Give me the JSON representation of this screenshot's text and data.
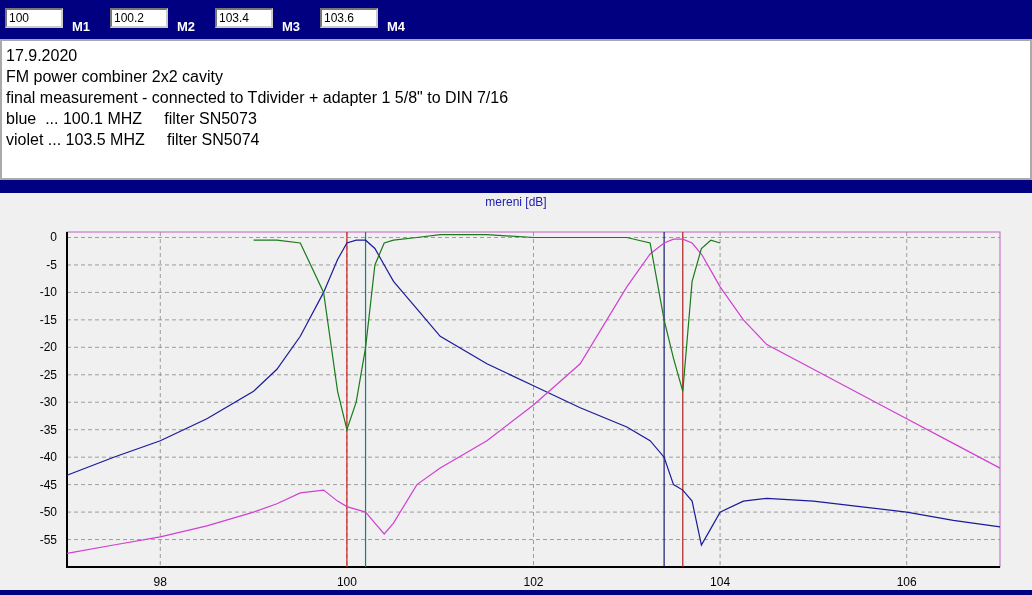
{
  "markers": [
    {
      "value": "100",
      "label": "M1"
    },
    {
      "value": "100.2",
      "label": "M2"
    },
    {
      "value": "103.4",
      "label": "M3"
    },
    {
      "value": "103.6",
      "label": "M4"
    }
  ],
  "notes": [
    "17.9.2020",
    "FM power combiner 2x2 cavity",
    "final measurement - connected to Tdivider + adapter 1 5/8\" to DIN 7/16",
    "blue  ... 100.1 MHZ     filter SN5073",
    "violet ... 103.5 MHZ     filter SN5074"
  ],
  "chart": {
    "chart_data": {
      "type": "line",
      "title": "mereni [dB]",
      "x": [
        97,
        97.5,
        98,
        98.5,
        99,
        99.25,
        99.5,
        99.75,
        99.9,
        100,
        100.1,
        100.2,
        100.3,
        100.4,
        100.5,
        100.75,
        101,
        101.5,
        102,
        102.5,
        103,
        103.25,
        103.4,
        103.5,
        103.6,
        103.7,
        103.8,
        103.9,
        104,
        104.25,
        104.5,
        105,
        105.5,
        106,
        106.5,
        107
      ],
      "series": [
        {
          "color": "#1a1a9a",
          "values": [
            -43.3,
            -40,
            -37,
            -33,
            -28,
            -24,
            -18,
            -10,
            -4,
            -1,
            -0.5,
            -0.5,
            -2,
            -5,
            -8,
            -13,
            -18,
            -23,
            -27,
            -31,
            -34.5,
            -37,
            -40,
            -45,
            -46,
            -48,
            -56,
            -53,
            -50,
            -48,
            -47.5,
            -48,
            -49,
            -50,
            -51.5,
            -52.7
          ]
        },
        {
          "color": "#d040d0",
          "values": [
            -57.5,
            -56,
            -54.5,
            -52.5,
            -50,
            -48.5,
            -46.5,
            -46,
            -48,
            -49,
            -49.5,
            -50,
            -52,
            -54,
            -52,
            -45,
            -42,
            -37,
            -30.5,
            -23,
            -9,
            -3,
            -1,
            -0.3,
            -0.3,
            -1,
            -3,
            -6,
            -9,
            -15,
            -19.5,
            -24,
            -28.5,
            -33,
            -37.5,
            -42
          ]
        },
        {
          "color": "#1a7a1a",
          "values": [
            null,
            null,
            null,
            null,
            -0.5,
            -0.5,
            -1,
            -10,
            -28,
            -35,
            -30,
            -20,
            -5,
            -1,
            -0.5,
            0,
            0.5,
            0.5,
            0,
            0,
            0,
            -1,
            -15,
            -22,
            -28,
            -8,
            -2,
            -0.5,
            -1,
            null,
            null,
            null,
            null,
            null,
            null,
            null
          ]
        }
      ],
      "xlim": [
        97,
        107
      ],
      "ylim": [
        -60,
        1
      ],
      "xticks": [
        98,
        100,
        102,
        104,
        106
      ],
      "yticks": [
        0,
        -5,
        -10,
        -15,
        -20,
        -25,
        -30,
        -35,
        -40,
        -45,
        -50,
        -55
      ],
      "grid": true,
      "ref_lines": [
        {
          "axis": "x",
          "value": 100,
          "color": "#d02020"
        },
        {
          "axis": "x",
          "value": 100.2,
          "color": "#108080"
        },
        {
          "axis": "x",
          "value": 103.4,
          "color": "#1a1a7a"
        },
        {
          "axis": "x",
          "value": 103.6,
          "color": "#b02020"
        }
      ]
    }
  }
}
